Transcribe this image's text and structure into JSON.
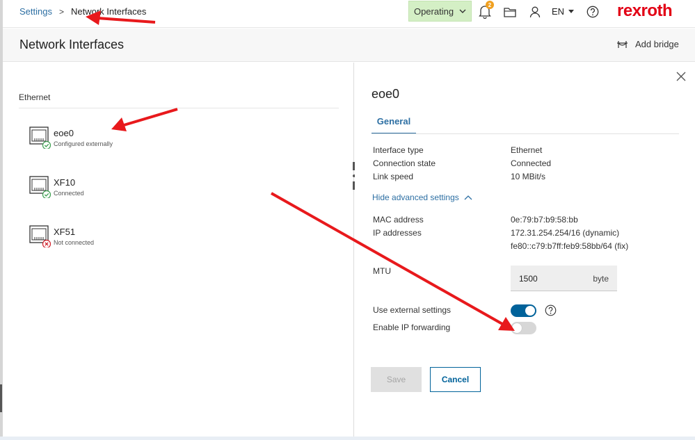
{
  "breadcrumb": {
    "root": "Settings",
    "separator": ">",
    "current": "Network Interfaces"
  },
  "header": {
    "mode_label": "Operating",
    "notification_count": "2",
    "language": "EN",
    "brand": "rexroth",
    "icons": [
      "bell-icon",
      "folder-icon",
      "user-icon",
      "help-icon"
    ]
  },
  "page": {
    "title": "Network Interfaces",
    "add_bridge_label": "Add bridge"
  },
  "interfaces": {
    "section_label": "Ethernet",
    "items": [
      {
        "name": "eoe0",
        "state": "Configured externally",
        "status": "ok"
      },
      {
        "name": "XF10",
        "state": "Connected",
        "status": "ok"
      },
      {
        "name": "XF51",
        "state": "Not connected",
        "status": "error"
      }
    ]
  },
  "detail": {
    "title": "eoe0",
    "tab_general": "General",
    "interface_type": {
      "label": "Interface type",
      "value": "Ethernet"
    },
    "connection_state": {
      "label": "Connection state",
      "value": "Connected"
    },
    "link_speed": {
      "label": "Link speed",
      "value": "10 MBit/s"
    },
    "advanced_toggle": "Hide advanced settings",
    "mac": {
      "label": "MAC address",
      "value": "0e:79:b7:b9:58:bb"
    },
    "ip": {
      "label": "IP addresses",
      "value_1": "172.31.254.254/16 (dynamic)",
      "value_2": "fe80::c79:b7ff:feb9:58bb/64 (fix)"
    },
    "mtu": {
      "label": "MTU",
      "value": "1500",
      "unit": "byte"
    },
    "external_settings": {
      "label": "Use external settings",
      "on": true
    },
    "ip_forwarding": {
      "label": "Enable IP forwarding",
      "on": false
    },
    "save_label": "Save",
    "cancel_label": "Cancel"
  },
  "colors": {
    "accent": "#00629a",
    "link": "#2d6fa3",
    "brand": "#e20015",
    "operating_bg": "#d4efc5",
    "annotation": "#e8191c"
  }
}
